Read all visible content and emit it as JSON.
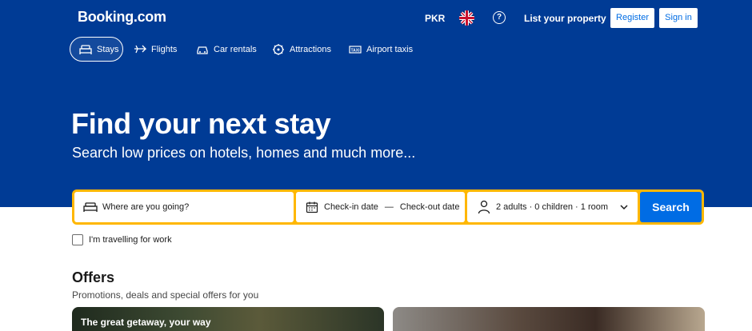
{
  "header": {
    "logo": "Booking.com",
    "currency": "PKR",
    "language_icon": "uk-flag-icon",
    "help_icon": "question-circle-icon",
    "list_property": "List your property",
    "register": "Register",
    "sign_in": "Sign in"
  },
  "nav": {
    "items": [
      {
        "label": "Stays",
        "icon": "bed-icon",
        "active": true
      },
      {
        "label": "Flights",
        "icon": "plane-icon",
        "active": false
      },
      {
        "label": "Car rentals",
        "icon": "car-icon",
        "active": false
      },
      {
        "label": "Attractions",
        "icon": "attractions-icon",
        "active": false
      },
      {
        "label": "Airport taxis",
        "icon": "taxi-icon",
        "active": false
      }
    ]
  },
  "hero": {
    "title": "Find your next stay",
    "subtitle": "Search low prices on hotels, homes and much more..."
  },
  "search": {
    "destination_placeholder": "Where are you going?",
    "checkin": "Check-in date",
    "dash": "—",
    "checkout": "Check-out date",
    "occupancy": "2 adults · 0 children · 1 room",
    "button": "Search"
  },
  "work_checkbox": {
    "label": "I'm travelling for work",
    "checked": false
  },
  "offers": {
    "title": "Offers",
    "subtitle": "Promotions, deals and special offers for you",
    "cards": [
      {
        "text": "The great getaway, your way"
      },
      {
        "text": ""
      }
    ]
  },
  "colors": {
    "brand_blue": "#003b95",
    "accent_yellow": "#ffb700",
    "button_blue": "#006ce4"
  }
}
